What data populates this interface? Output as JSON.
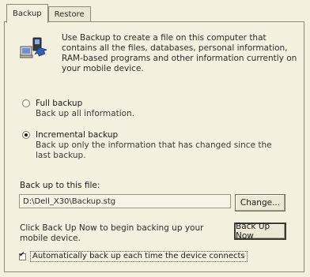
{
  "tabs": [
    {
      "label": "Backup",
      "active": true
    },
    {
      "label": "Restore",
      "active": false
    }
  ],
  "description": "Use Backup to create a file on this computer that contains all the files, databases, personal information, RAM-based programs and other information currently on your mobile device.",
  "options": {
    "full": {
      "title": "Full backup",
      "subtitle": "Back up all information.",
      "selected": false
    },
    "incremental": {
      "title": "Incremental backup",
      "subtitle": "Back up only the information that has changed since the last backup.",
      "selected": true
    }
  },
  "file": {
    "label": "Back up to this file:",
    "value": "D:\\Dell_X30\\Backup.stg",
    "change_label": "Change..."
  },
  "note": "Click Back Up Now to begin backing up your mobile device.",
  "backup_now_label": "Back Up Now",
  "auto_backup": {
    "label": "Automatically back up each time the device connects",
    "checked": true
  },
  "icon": "backup-icon",
  "colors": {
    "background": "#f4f0df",
    "border": "#8e8a78",
    "icon_blue": "#2f5fb8"
  }
}
